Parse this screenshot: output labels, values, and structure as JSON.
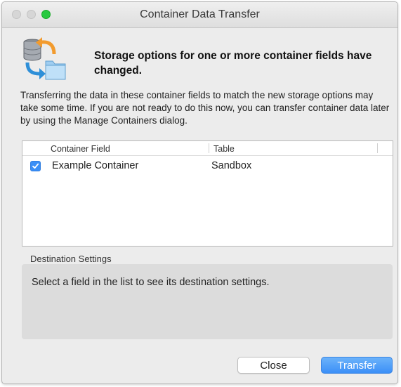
{
  "window": {
    "title": "Container Data Transfer"
  },
  "dialog": {
    "headline": "Storage options for one or more container fields have changed.",
    "description": "Transferring the data in these container fields to match the new storage options may take some time. If you are not ready to do this now, you can transfer container data later by using the Manage Containers dialog.",
    "icon": "database-transfer-icon"
  },
  "table": {
    "columns": [
      "Container Field",
      "Table"
    ],
    "rows": [
      {
        "checked": true,
        "field": "Example Container",
        "table": "Sandbox"
      }
    ]
  },
  "destination": {
    "label": "Destination Settings",
    "message": "Select a field in the list to see its destination settings."
  },
  "buttons": {
    "close": "Close",
    "transfer": "Transfer"
  },
  "colors": {
    "accent": "#3b8ff7",
    "window_bg": "#ececec",
    "zoom_button": "#27c93f"
  }
}
